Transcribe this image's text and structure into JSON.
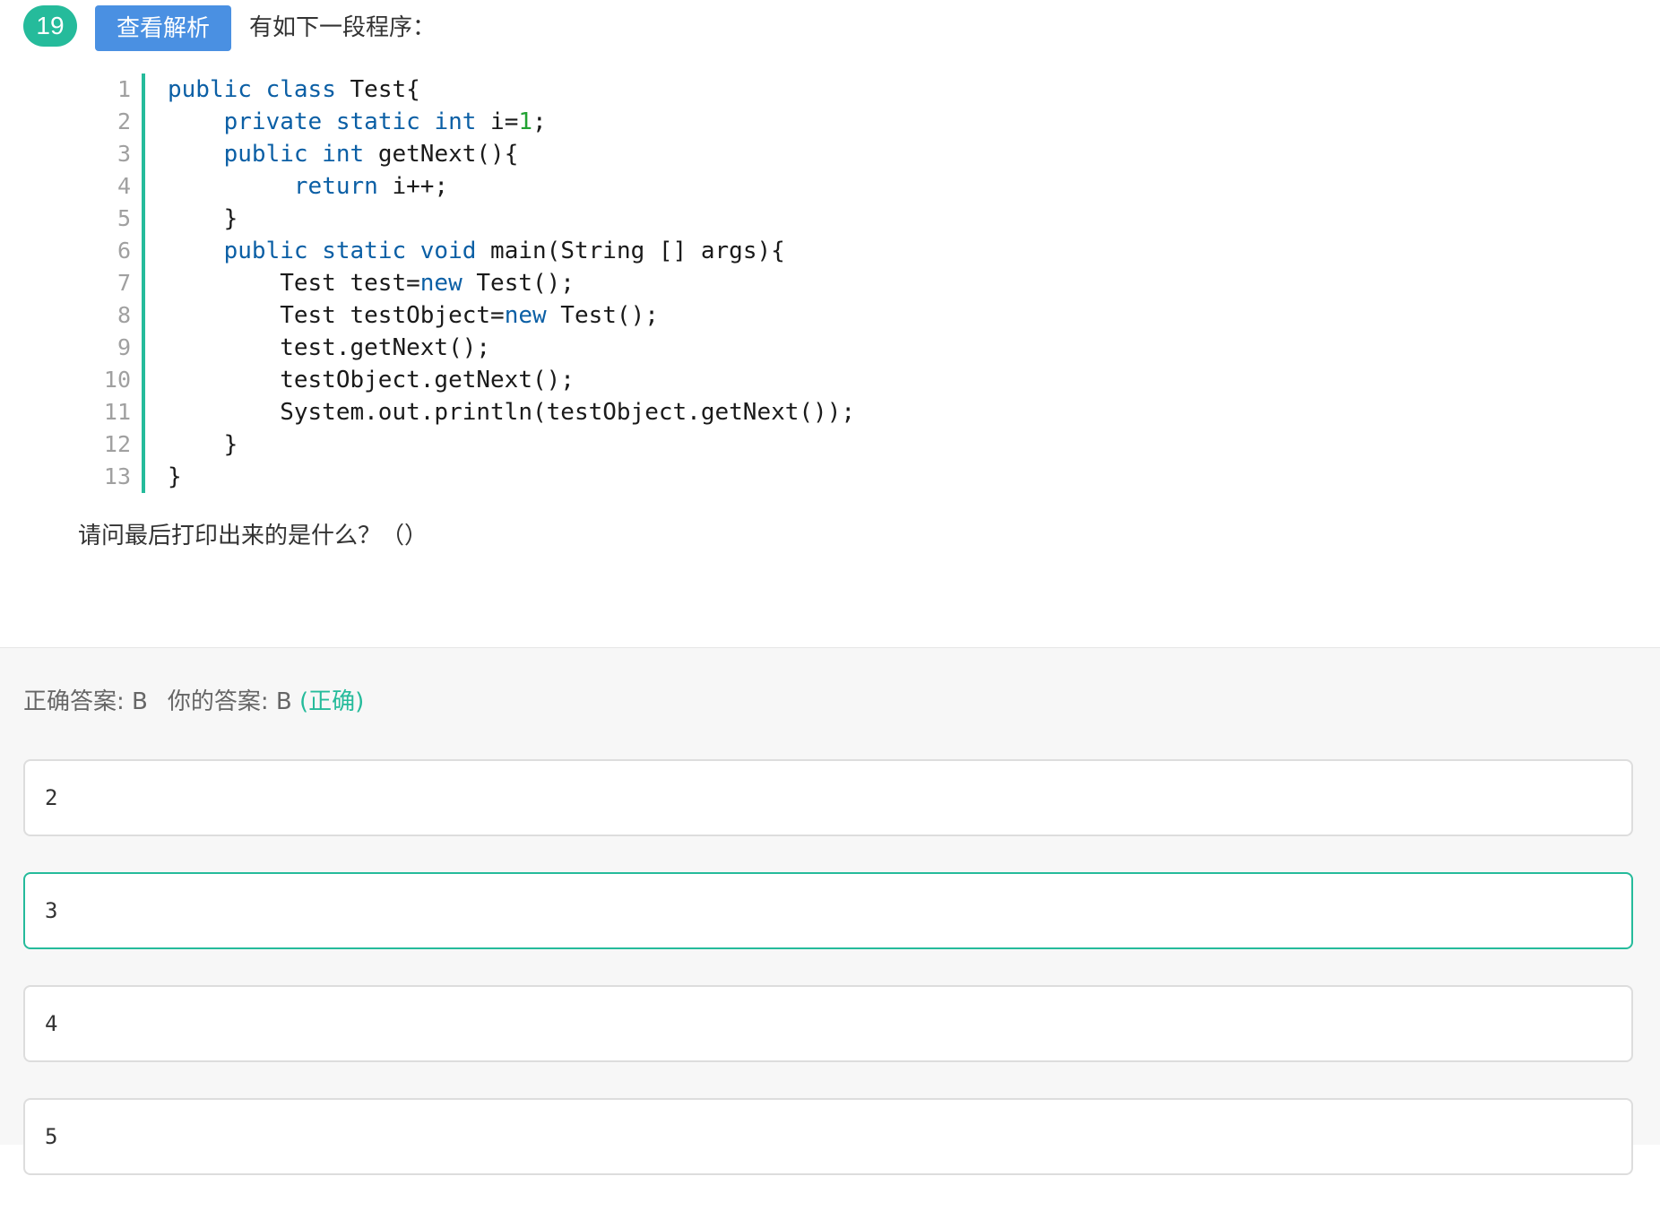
{
  "question": {
    "number": "19",
    "analysis_button": "查看解析",
    "intro": "有如下一段程序：",
    "prompt": "请问最后打印出来的是什么？（）"
  },
  "code": {
    "line_numbers": [
      "1",
      "2",
      "3",
      "4",
      "5",
      "6",
      "7",
      "8",
      "9",
      "10",
      "11",
      "12",
      "13"
    ],
    "lines": [
      "public class Test{",
      "    private static int i=1;",
      "    public int getNext(){",
      "         return i++;",
      "    }",
      "    public static void main(String [] args){",
      "        Test test=new Test();",
      "        Test testObject=new Test();",
      "        test.getNext();",
      "        testObject.getNext();",
      "        System.out.println(testObject.getNext());",
      "    }",
      "}"
    ]
  },
  "answer": {
    "correct_label": "正确答案: B",
    "your_label": "你的答案: B",
    "result": "(正确)"
  },
  "options": [
    {
      "label": "2",
      "state": "normal"
    },
    {
      "label": "3",
      "state": "correct"
    },
    {
      "label": "4",
      "state": "normal"
    },
    {
      "label": "5",
      "state": "normal"
    }
  ],
  "colors": {
    "accent": "#25bb9b",
    "button": "#4a90e2",
    "keyword": "#0b5fa5",
    "number": "#22a233"
  }
}
